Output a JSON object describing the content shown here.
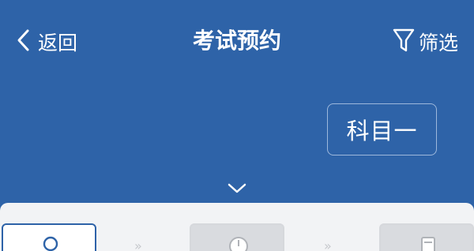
{
  "header": {
    "back_label": "返回",
    "title": "考试预约",
    "filter_label": "筛选"
  },
  "subject": {
    "label": "科目一"
  },
  "colors": {
    "brand_blue": "#2e63a8",
    "panel_bg": "#f2f3f5"
  },
  "icons": {
    "back": "chevron-left-icon",
    "filter": "funnel-icon",
    "expand": "chevron-down-icon",
    "steps": [
      "user-icon",
      "clock-icon",
      "document-icon"
    ]
  }
}
